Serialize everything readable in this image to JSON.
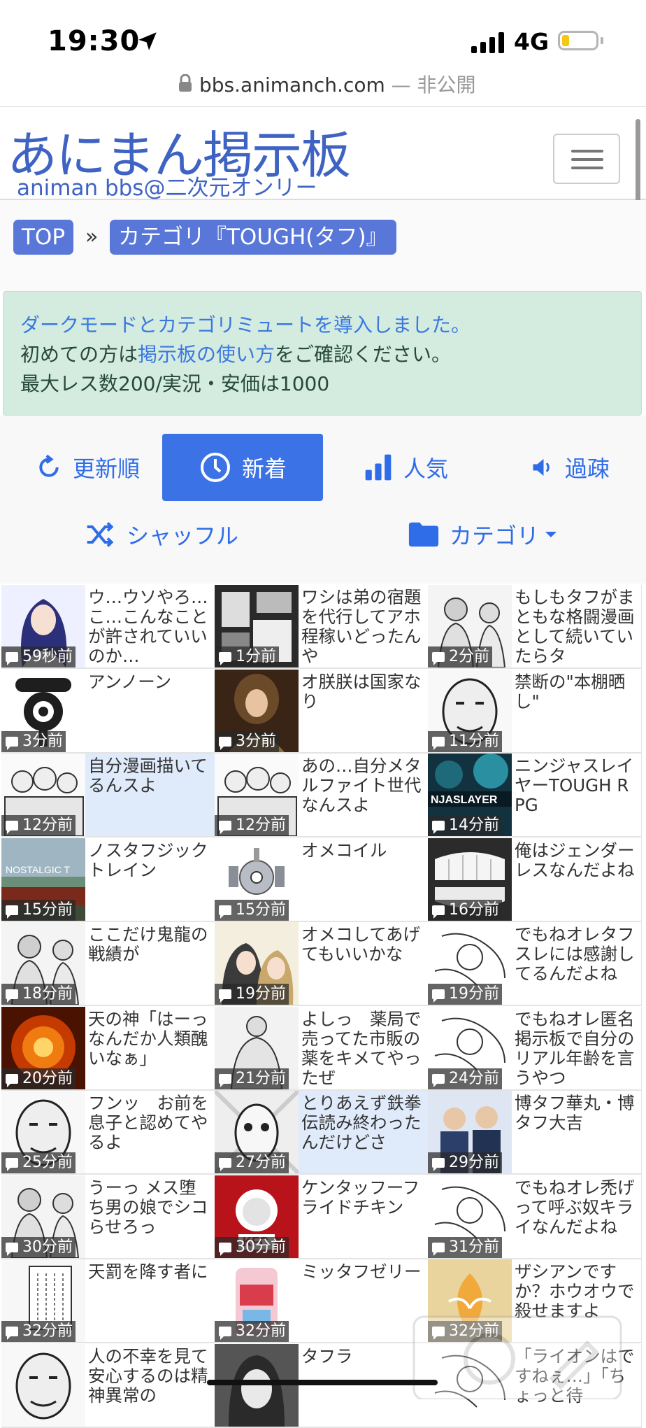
{
  "status": {
    "time": "19:30",
    "network": "4G"
  },
  "url": {
    "domain": "bbs.animanch.com",
    "suffix": " — 非公開"
  },
  "header": {
    "logo": "あにまん掲示板",
    "subtitle": "animan bbs@二次元オンリー"
  },
  "breadcrumb": {
    "home": "TOP",
    "separator": "»",
    "current": "カテゴリ『TOUGH(タフ)』"
  },
  "notice": {
    "line1_link": "ダークモードとカテゴリミュートを導入しました。",
    "line2_prefix": "初めての方は",
    "line2_link": "掲示板の使い方",
    "line2_suffix": "をご確認ください。",
    "line3": "最大レス数200/実況・安価は1000"
  },
  "sort": {
    "updated": "更新順",
    "new": "新着",
    "popular": "人気",
    "old": "過疎",
    "shuffle": "シャッフル",
    "category": "カテゴリ"
  },
  "colors": {
    "brand": "#3e63c3",
    "accent": "#3b72e6",
    "notice_bg": "#d4ebe0",
    "highlight_row": "#dfeafa"
  },
  "threads": [
    {
      "title": "ウ…ウソやろ…こ…こんなことが許されていいのか…",
      "time": "59秒前",
      "thumb": "anime-girl"
    },
    {
      "title": "ワシは弟の宿題を代行してアホ程稼いどったんや",
      "time": "1分前",
      "thumb": "manga-room"
    },
    {
      "title": "もしもタフがまともな格闘漫画として続いていたらタ",
      "time": "2分前",
      "thumb": "manga-fighters"
    },
    {
      "title": "アンノーン",
      "time": "3分前",
      "thumb": "unown"
    },
    {
      "title": "オ朕朕は国家なり",
      "time": "3分前",
      "thumb": "painting"
    },
    {
      "title": "禁断の\"本棚晒し\"",
      "time": "11分前",
      "thumb": "manga-face"
    },
    {
      "title": "自分漫画描いてるんスよ",
      "time": "12分前",
      "thumb": "manga-group"
    },
    {
      "title": "あの…自分メタルファイト世代なんスよ",
      "time": "12分前",
      "thumb": "manga-group"
    },
    {
      "title": "ニンジャスレイヤーTOUGH RPG",
      "time": "14分前",
      "thumb": "ninja"
    },
    {
      "title": "ノスタフジック　トレイン",
      "time": "15分前",
      "thumb": "train"
    },
    {
      "title": "オメコイル",
      "time": "15分前",
      "thumb": "magnemite"
    },
    {
      "title": "俺はジェンダーレスなんだよね",
      "time": "16分前",
      "thumb": "teeth"
    },
    {
      "title": "ここだけ鬼龍の戦績が",
      "time": "18分前",
      "thumb": "manga-fighters"
    },
    {
      "title": "オメコしてあげてもいいかな",
      "time": "19分前",
      "thumb": "anime-couple"
    },
    {
      "title": "でもねオレタフスレには感謝してるんだよね",
      "time": "19分前",
      "thumb": "manga-sketch"
    },
    {
      "title": "天の神「はーっなんだか人類醜いなぁ」",
      "time": "20分前",
      "thumb": "explosion"
    },
    {
      "title": "よしっ　薬局で売ってた市販の薬をキメてやったぜ",
      "time": "21分前",
      "thumb": "manga-muscle"
    },
    {
      "title": "でもねオレ匿名掲示板で自分のリアル年齢を言うやつ",
      "time": "24分前",
      "thumb": "manga-sketch"
    },
    {
      "title": "フンッ　お前を息子と認めてやるよ",
      "time": "25分前",
      "thumb": "manga-face"
    },
    {
      "title": "とりあえず鉄拳伝読み終わったんだけどさ",
      "time": "27分前",
      "thumb": "manga-shock"
    },
    {
      "title": "博タフ華丸・博タフ大吉",
      "time": "29分前",
      "thumb": "comedians"
    },
    {
      "title": "うーっ メス堕ち男の娘でシコらせろっ",
      "time": "30分前",
      "thumb": "manga-fighters"
    },
    {
      "title": "ケンタッフーフライドチキン",
      "time": "30分前",
      "thumb": "kfc"
    },
    {
      "title": "でもねオレ禿げって呼ぶ奴キライなんだよね",
      "time": "31分前",
      "thumb": "manga-sketch"
    },
    {
      "title": "天罰を降す者に",
      "time": "32分前",
      "thumb": "manga-text"
    },
    {
      "title": "ミッタフゼリー",
      "time": "32分前",
      "thumb": "jelly"
    },
    {
      "title": "ザシアンですか？ホウオウで殺せますよ",
      "time": "32分前",
      "thumb": "pokemon-bird"
    },
    {
      "title": "人の不幸を見て安心するのは精神異常の",
      "time": "",
      "thumb": "manga-face"
    },
    {
      "title": "タフラ",
      "time": "",
      "thumb": "manga-hair"
    },
    {
      "title": "「ライオンはですねぇ…」「ちょっと待",
      "time": "",
      "thumb": "manga-sketch"
    }
  ]
}
